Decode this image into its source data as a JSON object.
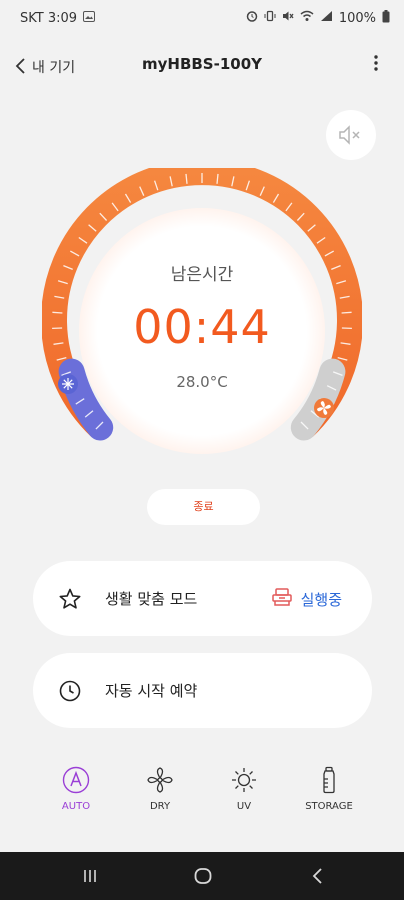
{
  "status_bar": {
    "carrier_time": "SKT 3:09",
    "battery": "100%"
  },
  "header": {
    "back_label": "내 기기",
    "device_title": "myHBBS-100Y"
  },
  "dial": {
    "remaining_label": "남은시간",
    "timer": "00:44",
    "temperature": "28.0°C",
    "colors": {
      "orange": "#f26a2e",
      "blue": "#6b6fd9",
      "gray": "#cccccc"
    }
  },
  "end_button": {
    "label": "종료"
  },
  "cards": [
    {
      "label": "생활 맞춤 모드",
      "icon": "star-icon",
      "status": "실행중"
    },
    {
      "label": "자동 시작 예약",
      "icon": "clock-icon"
    }
  ],
  "tabs": [
    {
      "label": "AUTO",
      "icon": "auto-icon",
      "active": true
    },
    {
      "label": "DRY",
      "icon": "fan-icon",
      "active": false
    },
    {
      "label": "UV",
      "icon": "sun-icon",
      "active": false
    },
    {
      "label": "STORAGE",
      "icon": "bottle-icon",
      "active": false
    }
  ]
}
